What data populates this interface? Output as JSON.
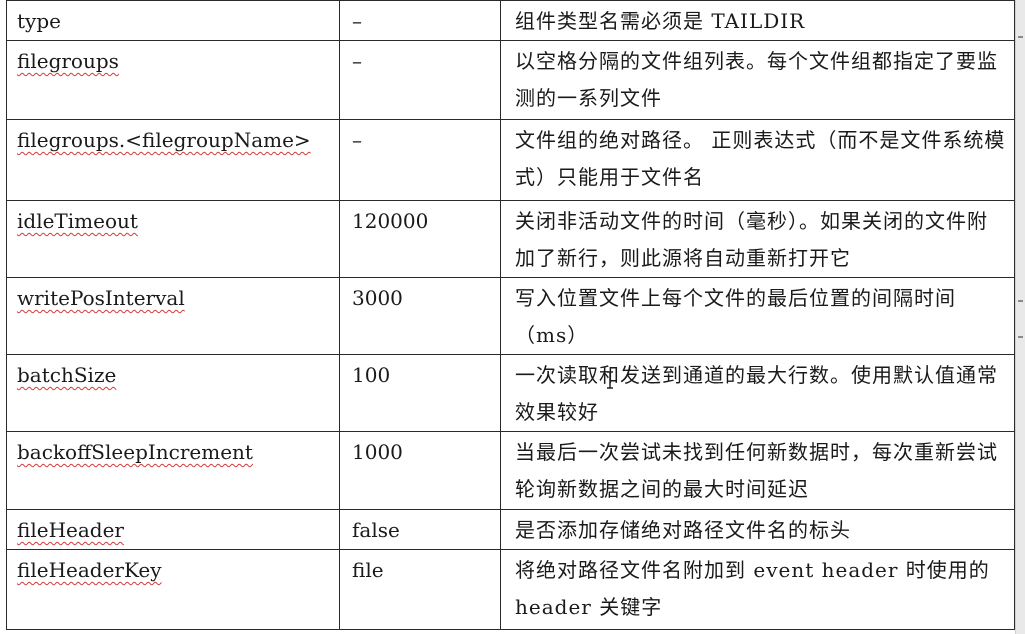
{
  "rows": [
    {
      "name": "type",
      "default": "–",
      "desc": "组件类型名需必须是 TAILDIR"
    },
    {
      "name": "filegroups",
      "default": "–",
      "desc": "以空格分隔的文件组列表。每个文件组都指定了要监测的一系列文件"
    },
    {
      "name": "filegroups.<filegroupName>",
      "default": "–",
      "desc": "文件组的绝对路径。 正则表达式（而不是文件系统模式）只能用于文件名"
    },
    {
      "name": "idleTimeout",
      "default": "120000",
      "desc": "关闭非活动文件的时间（毫秒）。如果关闭的文件附加了新行，则此源将自动重新打开它"
    },
    {
      "name": "writePosInterval",
      "default": "3000",
      "desc": "写入位置文件上每个文件的最后位置的间隔时间（ms）"
    },
    {
      "name": "batchSize",
      "default": "100",
      "desc": "一次读取和发送到通道的最大行数。使用默认值通常效果较好"
    },
    {
      "name": "backoffSleepIncrement",
      "default": "1000",
      "desc": "当最后一次尝试未找到任何新数据时，每次重新尝试轮询新数据之间的最大时间延迟"
    },
    {
      "name": "fileHeader",
      "default": "false",
      "desc": "是否添加存储绝对路径文件名的标头"
    },
    {
      "name": "fileHeaderKey",
      "default": "file",
      "desc": "将绝对路径文件名附加到 event header 时使用的 header 关键字"
    }
  ]
}
